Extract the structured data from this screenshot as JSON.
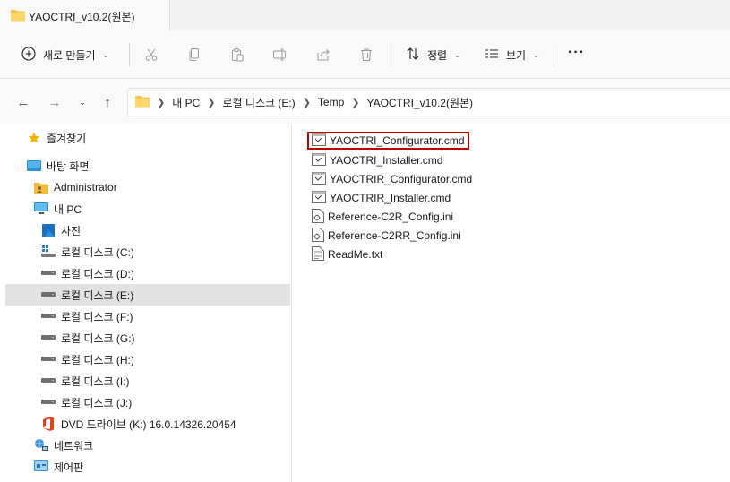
{
  "window": {
    "title": "YAOCTRI_v10.2(원본)"
  },
  "toolbar": {
    "new_label": "새로 만들기",
    "sort_label": "정렬",
    "view_label": "보기",
    "more_label": "···"
  },
  "navigation": {
    "breadcrumbs": [
      "내 PC",
      "로컬 디스크 (E:)",
      "Temp",
      "YAOCTRI_v10.2(원본)"
    ]
  },
  "sidebar": {
    "items": [
      {
        "label": "즐겨찾기",
        "icon": "star-icon"
      },
      {
        "label": "바탕 화면",
        "icon": "desktop-icon"
      },
      {
        "label": "Administrator",
        "icon": "user-folder-icon"
      },
      {
        "label": "내 PC",
        "icon": "pc-icon"
      },
      {
        "label": "사진",
        "icon": "photos-icon"
      },
      {
        "label": "로컬 디스크 (C:)",
        "icon": "system-drive-icon"
      },
      {
        "label": "로컬 디스크 (D:)",
        "icon": "drive-icon"
      },
      {
        "label": "로컬 디스크 (E:)",
        "icon": "drive-icon",
        "selected": true
      },
      {
        "label": "로컬 디스크 (F:)",
        "icon": "drive-icon"
      },
      {
        "label": "로컬 디스크 (G:)",
        "icon": "drive-icon"
      },
      {
        "label": "로컬 디스크 (H:)",
        "icon": "drive-icon"
      },
      {
        "label": "로컬 디스크 (I:)",
        "icon": "drive-icon"
      },
      {
        "label": "로컬 디스크 (J:)",
        "icon": "drive-icon"
      },
      {
        "label": "DVD 드라이브 (K:) 16.0.14326.20454",
        "icon": "office-dvd-icon"
      },
      {
        "label": "네트워크",
        "icon": "network-icon"
      },
      {
        "label": "제어판",
        "icon": "control-panel-icon"
      }
    ]
  },
  "files": [
    {
      "name": "YAOCTRI_Configurator.cmd",
      "icon": "cmd-file-icon",
      "highlighted": true
    },
    {
      "name": "YAOCTRI_Installer.cmd",
      "icon": "cmd-file-icon"
    },
    {
      "name": "YAOCTRIR_Configurator.cmd",
      "icon": "cmd-file-icon"
    },
    {
      "name": "YAOCTRIR_Installer.cmd",
      "icon": "cmd-file-icon"
    },
    {
      "name": "Reference-C2R_Config.ini",
      "icon": "ini-file-icon"
    },
    {
      "name": "Reference-C2RR_Config.ini",
      "icon": "ini-file-icon"
    },
    {
      "name": "ReadMe.txt",
      "icon": "txt-file-icon"
    }
  ],
  "colors": {
    "highlight_border": "#c00000",
    "selected_bg": "#e2e2e2",
    "accent": "#0067c0"
  }
}
